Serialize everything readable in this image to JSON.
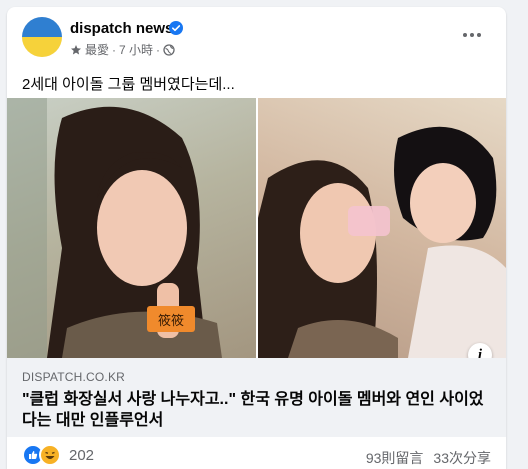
{
  "post": {
    "page_name": "dispatch news",
    "audience_label": "最愛",
    "time_label": "7 小時",
    "separator": "·",
    "caption": "2세대 아이돌 그룹 멤버였다는데..."
  },
  "link": {
    "domain": "DISPATCH.CO.KR",
    "title": "\"클럽 화장실서 사랑 나누자고..\" 한국 유명 아이돌 멤버와 연인 사이었다는 대만 인플루언서"
  },
  "engagement": {
    "reaction_count": "202",
    "comments": "93則留言",
    "shares": "33次分享"
  },
  "media": {
    "left_name_tag": "筱筱",
    "info_button": "i"
  },
  "colors": {
    "accent": "#1877f2",
    "secondary_text": "#65676b",
    "avatar_top": "#2f7fd1",
    "avatar_bottom": "#f6d23a"
  },
  "icons": {
    "verified": "verified-badge-icon",
    "star": "star-icon",
    "globe": "globe-icon",
    "more": "more-dots-icon",
    "like": "like-reaction-icon",
    "haha": "haha-reaction-icon",
    "info": "info-icon"
  }
}
